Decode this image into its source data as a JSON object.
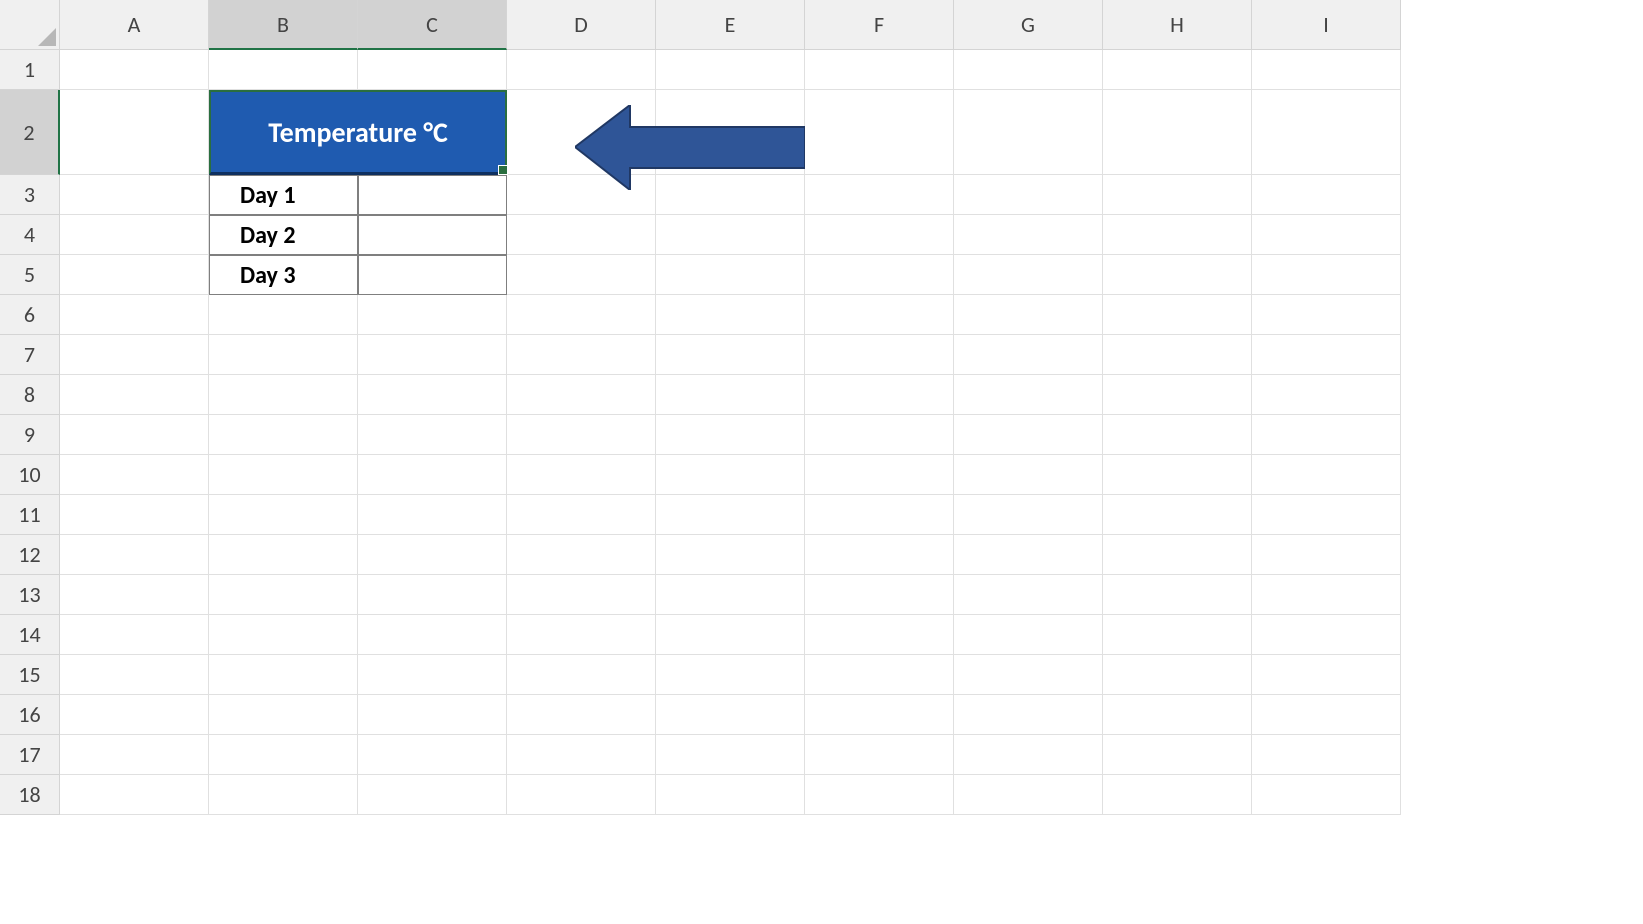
{
  "columns": [
    "A",
    "B",
    "C",
    "D",
    "E",
    "F",
    "G",
    "H",
    "I"
  ],
  "rows": [
    "1",
    "2",
    "3",
    "4",
    "5",
    "6",
    "7",
    "8",
    "9",
    "10",
    "11",
    "12",
    "13",
    "14",
    "15",
    "16",
    "17",
    "18"
  ],
  "selectedCols": [
    "B",
    "C"
  ],
  "selectedRows": [
    "2"
  ],
  "table": {
    "header": "Temperature  °C",
    "rows": [
      "Day 1",
      "Day 2",
      "Day 3"
    ]
  },
  "colors": {
    "headerBg": "#1f5bb0",
    "headerText": "#ffffff",
    "arrowFill": "#2f5597",
    "arrowStroke": "#203864"
  }
}
